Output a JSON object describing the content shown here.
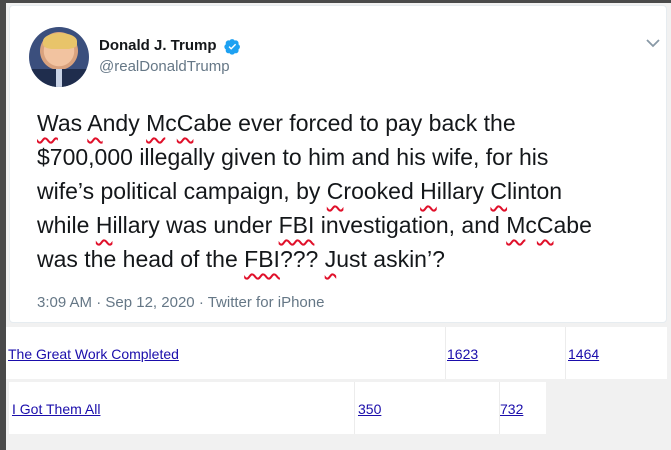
{
  "tweet": {
    "author_name": "Donald J. Trump",
    "author_handle": "@realDonaldTrump",
    "text_lines": [
      "Was Andy McCabe ever forced to pay back the",
      "$700,000 illegally given to him and his wife, for his",
      "wife’s political campaign, by Crooked Hillary Clinton",
      "while Hillary was under FBI investigation, and McCabe",
      "was the head of the FBI??? Just askin’?"
    ],
    "time": "3:09 AM",
    "date": "Sep 12, 2020",
    "source": "Twitter for iPhone",
    "separator": "·",
    "verified_icon": "verified-badge-icon",
    "menu_icon": "chevron-down-icon",
    "accent_color": "#1da1f2"
  },
  "table_rows": [
    {
      "title": "The Great Work Completed",
      "value_a": "1623",
      "value_b": "1464"
    },
    {
      "title": "I Got Them All",
      "value_a": "350",
      "value_b": "732"
    }
  ]
}
